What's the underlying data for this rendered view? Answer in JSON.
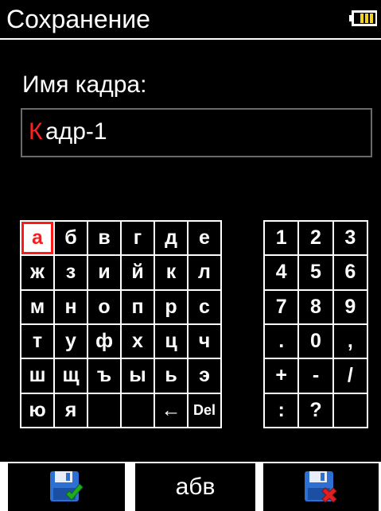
{
  "header": {
    "title": "Сохранение",
    "battery_icon": "battery-icon"
  },
  "form": {
    "label": "Имя кадра:",
    "cursor_char": "К",
    "value_rest": "адр-1"
  },
  "alpha_keys": [
    "а",
    "б",
    "в",
    "г",
    "д",
    "е",
    "ж",
    "з",
    "и",
    "й",
    "к",
    "л",
    "м",
    "н",
    "о",
    "п",
    "р",
    "с",
    "т",
    "у",
    "ф",
    "х",
    "ц",
    "ч",
    "ш",
    "щ",
    "ъ",
    "ы",
    "ь",
    "э",
    "ю",
    "я",
    "",
    "",
    "←",
    "Del"
  ],
  "numeric_keys": [
    "1",
    "2",
    "3",
    "4",
    "5",
    "6",
    "7",
    "8",
    "9",
    ".",
    "0",
    ",",
    "+",
    "-",
    "/",
    ":",
    "?",
    ""
  ],
  "bottom": {
    "save_icon": "save-confirm-icon",
    "mode_label": "абв",
    "cancel_icon": "save-cancel-icon"
  },
  "colors": {
    "accent_red": "#ff1a1a",
    "battery_yellow": "#f2d21a",
    "green_check": "#22aa22"
  }
}
